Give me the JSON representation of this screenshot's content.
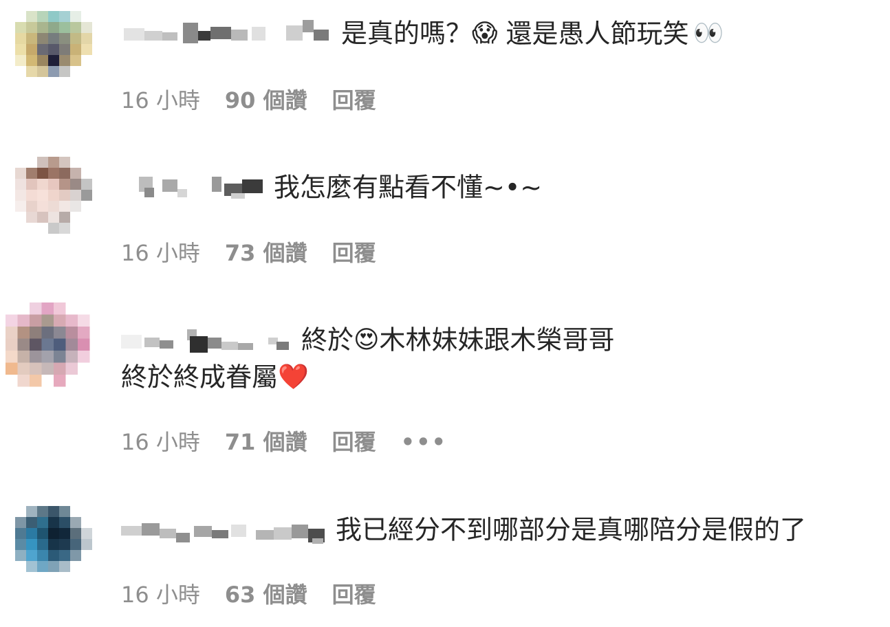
{
  "comments": [
    {
      "text_line1": "是真的嗎？",
      "emoji1": "😱",
      "text_line1b": "還是愚人節玩笑",
      "emoji2": "👀",
      "time": "16 小時",
      "likes": "90 個讚",
      "reply": "回覆"
    },
    {
      "text_line1": "我怎麼有點看不懂~•~",
      "time": "16 小時",
      "likes": "73 個讚",
      "reply": "回覆"
    },
    {
      "text_line1": "終於",
      "emoji1": "😍",
      "text_line1b": "木林妹妹跟木榮哥哥",
      "text_line2": "終於終成眷屬",
      "emoji2": "❤️",
      "time": "16 小時",
      "likes": "71 個讚",
      "reply": "回覆",
      "more": "•••"
    },
    {
      "text_line1": "我已經分不到哪部分是真哪陪分是假的了",
      "time": "16 小時",
      "likes": "63 個讚",
      "reply": "回覆"
    }
  ]
}
